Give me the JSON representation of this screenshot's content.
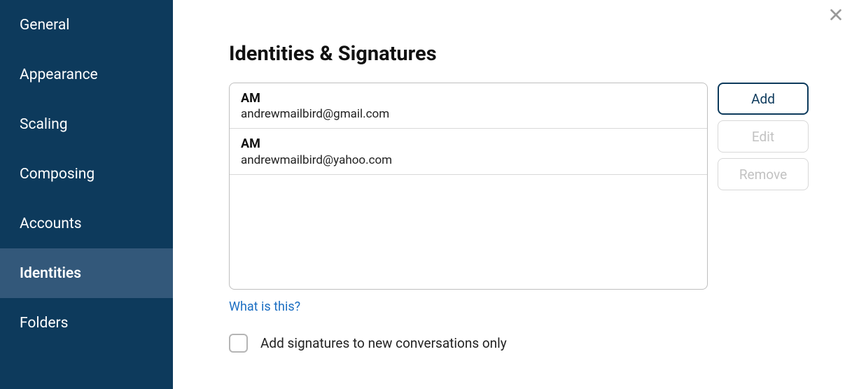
{
  "sidebar": {
    "items": [
      {
        "label": "General"
      },
      {
        "label": "Appearance"
      },
      {
        "label": "Scaling"
      },
      {
        "label": "Composing"
      },
      {
        "label": "Accounts"
      },
      {
        "label": "Identities"
      },
      {
        "label": "Folders"
      }
    ],
    "active_index": 5
  },
  "main": {
    "title": "Identities & Signatures",
    "identities": [
      {
        "name": "AM",
        "email": "andrewmailbird@gmail.com"
      },
      {
        "name": "AM",
        "email": "andrewmailbird@yahoo.com"
      }
    ],
    "actions": {
      "add_label": "Add",
      "edit_label": "Edit",
      "remove_label": "Remove"
    },
    "helper_link_label": "What is this?",
    "checkbox_label": "Add signatures to new conversations only",
    "checkbox_checked": false
  }
}
